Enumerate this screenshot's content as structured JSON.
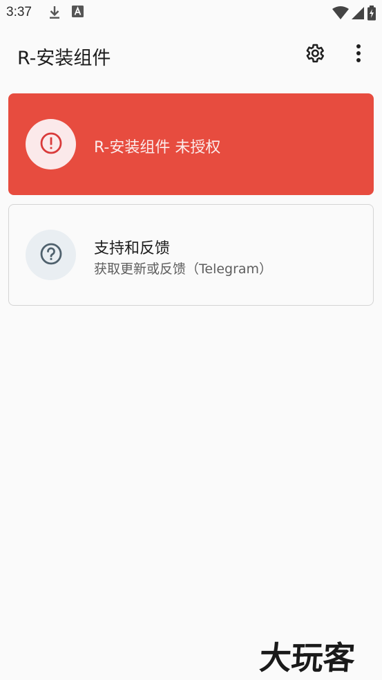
{
  "status_bar": {
    "time": "3:37",
    "icons": [
      "download-icon",
      "font-a-icon",
      "wifi-icon",
      "signal-icon",
      "battery-icon"
    ]
  },
  "app_bar": {
    "title": "R-安装组件",
    "actions": [
      "settings-icon",
      "more-vert-icon"
    ]
  },
  "cards": {
    "warning": {
      "text": "R-安装组件 未授权",
      "icon": "error-outline-icon",
      "color": "#e74c3f"
    },
    "support": {
      "title": "支持和反馈",
      "subtitle": "获取更新或反馈（Telegram）",
      "icon": "help-outline-icon"
    }
  },
  "watermark": {
    "text": "大玩客"
  }
}
